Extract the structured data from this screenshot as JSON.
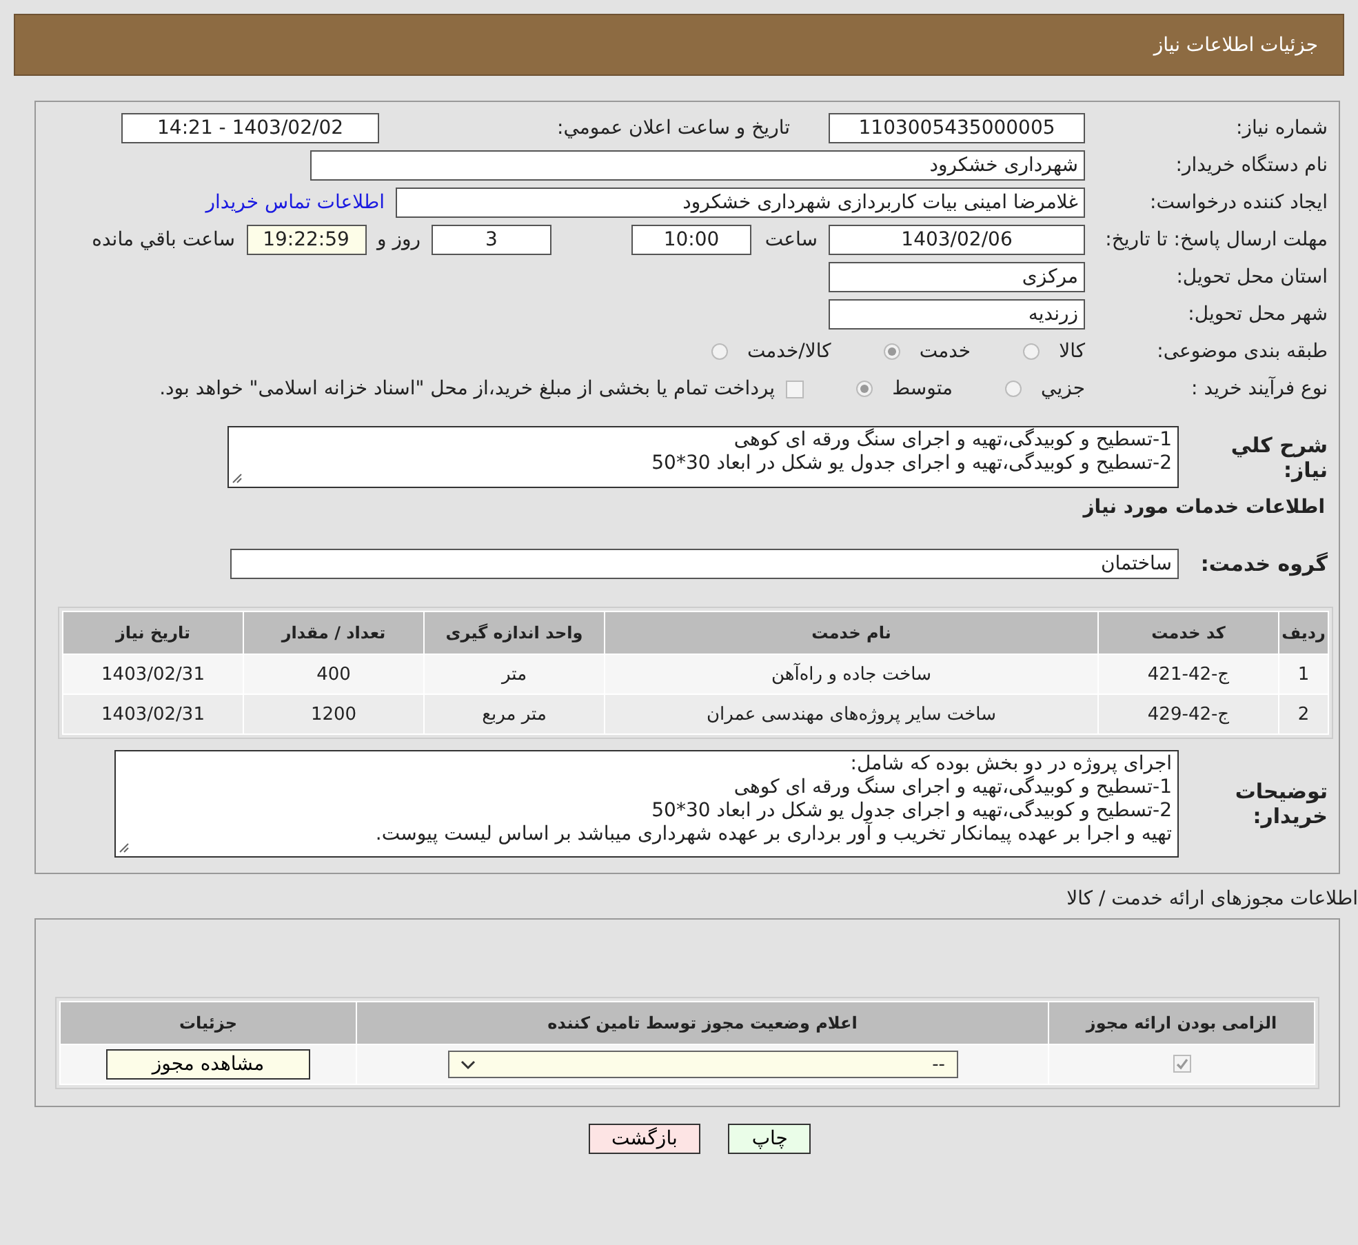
{
  "header": {
    "title": "جزئیات اطلاعات نیاز"
  },
  "need_number": {
    "label": "شماره نیاز:",
    "value": "1103005435000005"
  },
  "announce": {
    "label": "تاریخ و ساعت اعلان عمومي:",
    "value": "1403/02/02 - 14:21"
  },
  "buyer_org": {
    "label": "نام دستگاه خریدار:",
    "value": "شهرداری خشکرود"
  },
  "requester": {
    "label": "ایجاد کننده درخواست:",
    "value": "غلامرضا امینی بیات کاربردازی شهرداری خشکرود",
    "link": "اطلاعات تماس خریدار"
  },
  "deadline": {
    "label": "مهلت ارسال پاسخ: تا تاریخ:",
    "date": "1403/02/06",
    "time_label": "ساعت",
    "time": "10:00",
    "days": "3",
    "days_label": "روز و",
    "remaining": "19:22:59",
    "remaining_label": "ساعت باقي مانده"
  },
  "province": {
    "label": "استان محل تحویل:",
    "value": "مرکزی"
  },
  "city": {
    "label": "شهر محل تحویل:",
    "value": "زرندیه"
  },
  "category": {
    "label": "طبقه بندی موضوعی:",
    "options": [
      {
        "label": "کالا",
        "selected": false
      },
      {
        "label": "خدمت",
        "selected": true
      },
      {
        "label": "کالا/خدمت",
        "selected": false
      }
    ]
  },
  "purchase_type": {
    "label": "نوع فرآیند خرید :",
    "options": [
      {
        "label": "جزیي",
        "selected": false
      },
      {
        "label": "متوسط",
        "selected": true
      }
    ],
    "payment": {
      "label": "پرداخت تمام یا بخشی از مبلغ خرید،از محل \"اسناد خزانه اسلامی\" خواهد بود.",
      "checked": false
    }
  },
  "description": {
    "label": "شرح کلي نياز:",
    "lines": [
      "1-تسطیح و کوبیدگی،تهیه و اجرای سنگ ورقه ای کوهی",
      "2-تسطیح و کوبیدگی،تهیه و اجرای جدول یو شکل در ابعاد 30*50"
    ]
  },
  "services_title": "اطلاعات خدمات مورد نیاز",
  "service_group": {
    "label": "گروه خدمت:",
    "value": "ساختمان"
  },
  "services_table": {
    "columns": [
      "ردیف",
      "کد خدمت",
      "نام خدمت",
      "واحد اندازه گیری",
      "تعداد / مقدار",
      "تاریخ نیاز"
    ],
    "rows": [
      [
        "1",
        "ج-42-421",
        "ساخت جاده و راه‌آهن",
        "متر",
        "400",
        "1403/02/31"
      ],
      [
        "2",
        "ج-42-429",
        "ساخت سایر پروژه‌های مهندسی عمران",
        "متر مربع",
        "1200",
        "1403/02/31"
      ]
    ]
  },
  "buyer_notes": {
    "label": "توضیحات خریدار:",
    "lines": [
      "اجرای پروژه در دو بخش بوده که شامل:",
      "1-تسطیح و کوبیدگی،تهیه و اجرای سنگ ورقه ای کوهی",
      "2-تسطیح و کوبیدگی،تهیه و اجرای جدول یو شکل در ابعاد 30*50",
      "تهیه و اجرا بر عهده پیمانکار تخریب و آور برداری بر عهده شهرداری میباشد بر اساس لیست پیوست."
    ]
  },
  "permits_title": "اطلاعات مجوزهای ارائه خدمت / کالا",
  "permits_table": {
    "columns": [
      "الزامی بودن ارائه مجوز",
      "اعلام وضعیت مجوز توسط تامین کننده",
      "جزئیات"
    ],
    "rows": [
      {
        "required": true,
        "status": "--",
        "details_button": "مشاهده مجوز"
      }
    ]
  },
  "buttons": [
    {
      "label": "چاپ",
      "kind": "print"
    },
    {
      "label": "بازگشت",
      "kind": "back"
    }
  ]
}
